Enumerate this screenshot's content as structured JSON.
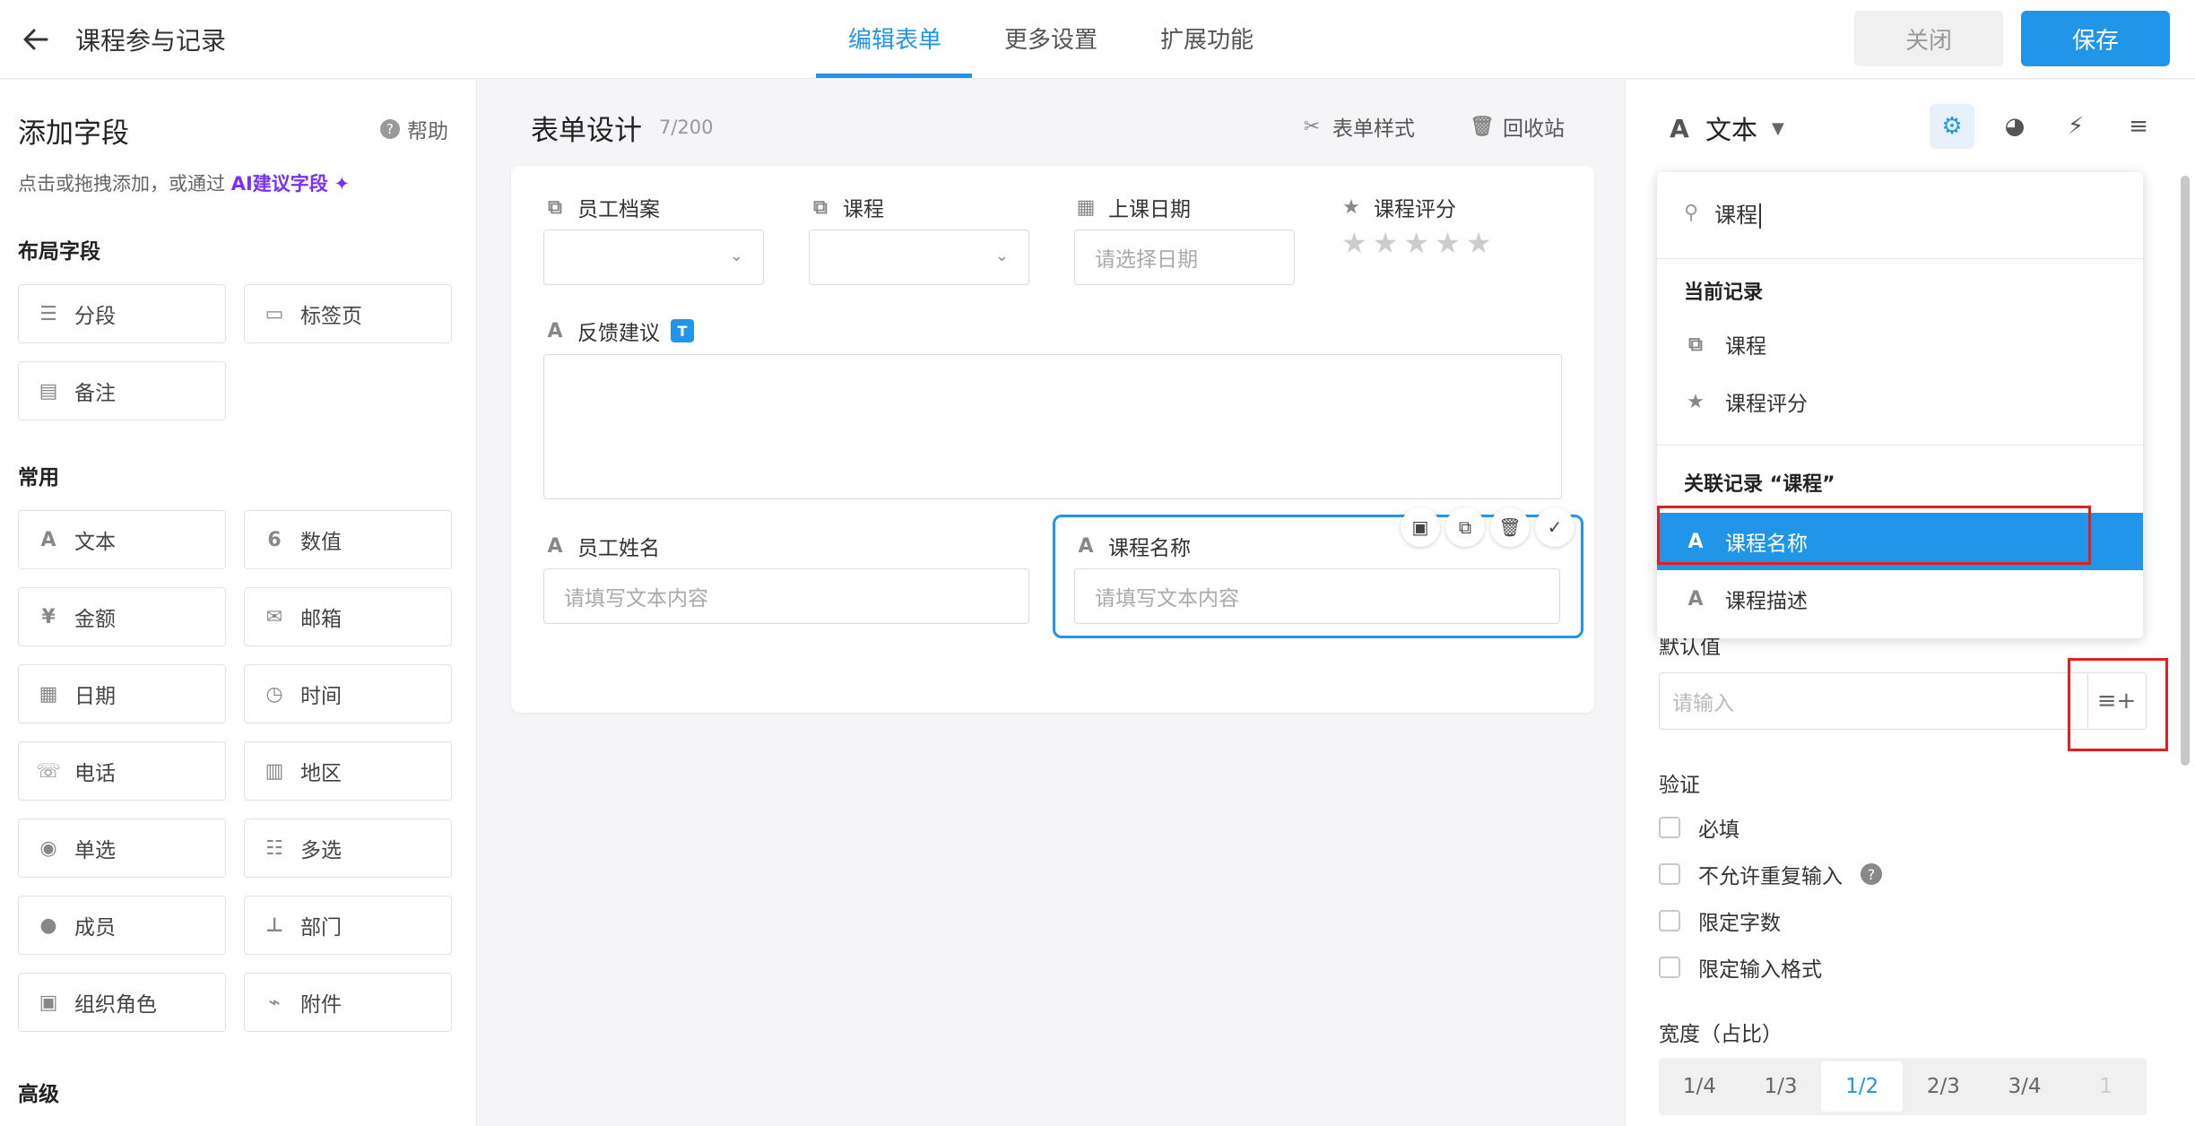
{
  "header": {
    "title": "课程参与记录",
    "tabs": [
      {
        "label": "编辑表单",
        "active": true
      },
      {
        "label": "更多设置",
        "active": false
      },
      {
        "label": "扩展功能",
        "active": false
      }
    ],
    "close_label": "关闭",
    "save_label": "保存"
  },
  "left_panel": {
    "title": "添加字段",
    "help_label": "帮助",
    "hint_prefix": "点击或拖拽添加，或通过",
    "hint_ai": "AI建议字段",
    "sections": {
      "layout": "布局字段",
      "common": "常用",
      "advanced": "高级"
    },
    "layout_fields": [
      "分段",
      "标签页",
      "备注"
    ],
    "common_fields": [
      "文本",
      "数值",
      "金额",
      "邮箱",
      "日期",
      "时间",
      "电话",
      "地区",
      "单选",
      "多选",
      "成员",
      "部门",
      "组织角色",
      "附件"
    ]
  },
  "center": {
    "title": "表单设计",
    "count": "7/200",
    "style_label": "表单样式",
    "recycle_label": "回收站",
    "fields": {
      "employee_record": "员工档案",
      "course": "课程",
      "class_date": "上课日期",
      "class_date_placeholder": "请选择日期",
      "course_rating": "课程评分",
      "feedback": "反馈建议",
      "employee_name": "员工姓名",
      "employee_name_placeholder": "请填写文本内容",
      "course_name": "课程名称",
      "course_name_placeholder": "请填写文本内容"
    },
    "rating_stars": "★★★★★"
  },
  "right_panel": {
    "field_type": "文本",
    "default_value_label": "默认值",
    "default_value_placeholder": "请输入",
    "validation_label": "验证",
    "validations": [
      {
        "label": "必填",
        "checked": false
      },
      {
        "label": "不允许重复输入",
        "checked": false
      },
      {
        "label": "限定字数",
        "checked": false
      },
      {
        "label": "限定输入格式",
        "checked": false
      }
    ],
    "width_label": "宽度（占比）",
    "width_options": [
      {
        "label": "1/4"
      },
      {
        "label": "1/3"
      },
      {
        "label": "1/2",
        "active": true
      },
      {
        "label": "2/3"
      },
      {
        "label": "3/4"
      },
      {
        "label": "1",
        "disabled": true
      }
    ]
  },
  "dropdown": {
    "search_value": "课程",
    "group_current": "当前记录",
    "current_items": [
      "课程",
      "课程评分"
    ],
    "group_related": "关联记录 “课程”",
    "related_items": [
      {
        "label": "课程名称",
        "selected": true
      },
      {
        "label": "课程描述",
        "selected": false
      }
    ]
  },
  "colors": {
    "accent": "#2196e8",
    "highlight": "#e02020",
    "ai_purple": "#7b2ff7"
  }
}
